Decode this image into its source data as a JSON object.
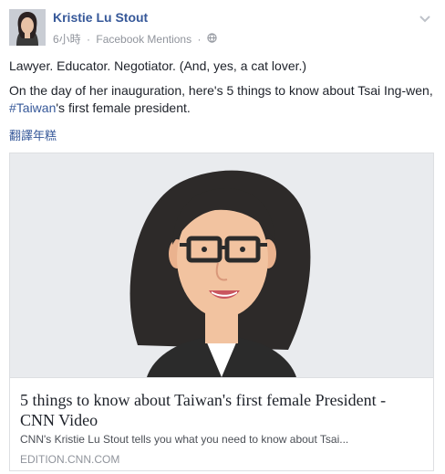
{
  "post": {
    "author": "Kristie Lu Stout",
    "time": "6小時",
    "separator": "·",
    "source": "Facebook Mentions",
    "privacy_icon": "globe-icon",
    "line1": "Lawyer. Educator. Negotiator. (And, yes, a cat lover.)",
    "line2_before": "On the day of her inauguration, here's 5 things to know about Tsai Ing-wen, ",
    "hashtag": "#Taiwan",
    "line2_after": "'s first female president.",
    "translate_label": "翻譯年糕"
  },
  "card": {
    "title": "5 things to know about Taiwan's first female President - CNN Video",
    "description": "CNN's Kristie Lu Stout tells you what you need to know about Tsai...",
    "domain": "EDITION.CNN.COM"
  },
  "colors": {
    "link": "#365899",
    "meta": "#90949c",
    "card_bg": "#e9ebee",
    "skin": "#f2c3a0"
  }
}
